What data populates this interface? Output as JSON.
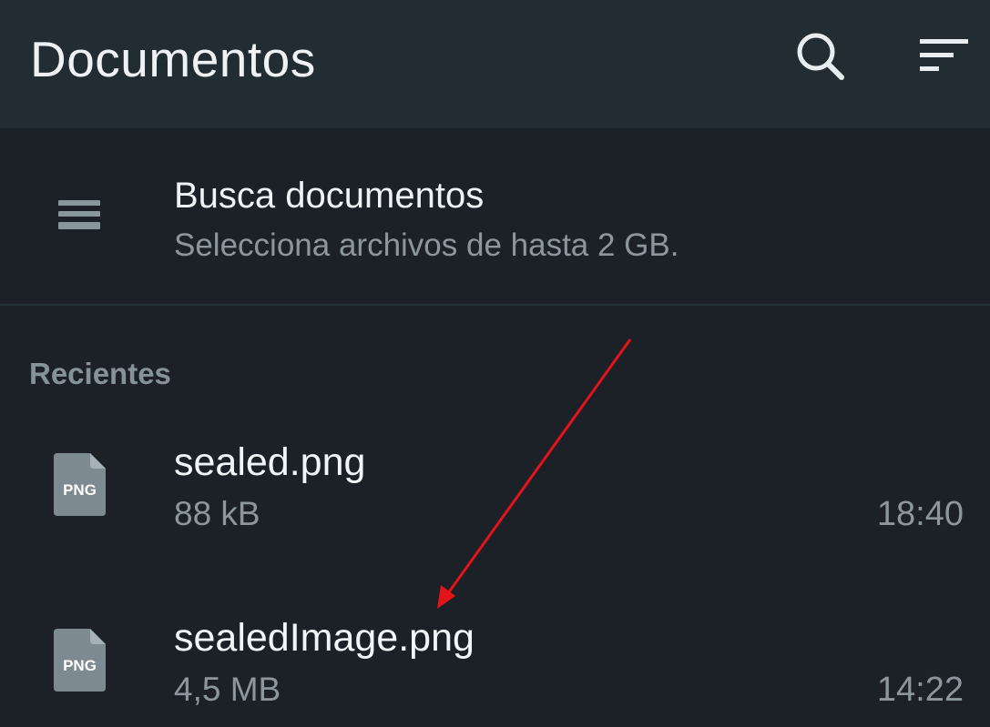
{
  "appbar": {
    "title": "Documentos",
    "actions": [
      {
        "icon": "search-icon"
      },
      {
        "icon": "sort-icon"
      }
    ]
  },
  "browse": {
    "icon": "document-list-icon",
    "title": "Busca documentos",
    "subtitle": "Selecciona archivos de hasta 2 GB."
  },
  "recent": {
    "header": "Recientes",
    "files": [
      {
        "icon_label": "PNG",
        "name": "sealed.png",
        "size": "88 kB",
        "time": "18:40"
      },
      {
        "icon_label": "PNG",
        "name": "sealedImage.png",
        "size": "4,5 MB",
        "time": "14:22"
      }
    ]
  },
  "annotation": {
    "type": "red-arrow",
    "color": "#e2141a",
    "points_to": "sealedImage.png"
  },
  "colors": {
    "appbar_bg": "#222c33",
    "screen_bg": "#1b2127",
    "primary_text": "#f0f3f5",
    "secondary_text": "#8c979d",
    "file_icon": "#7d8a91"
  }
}
